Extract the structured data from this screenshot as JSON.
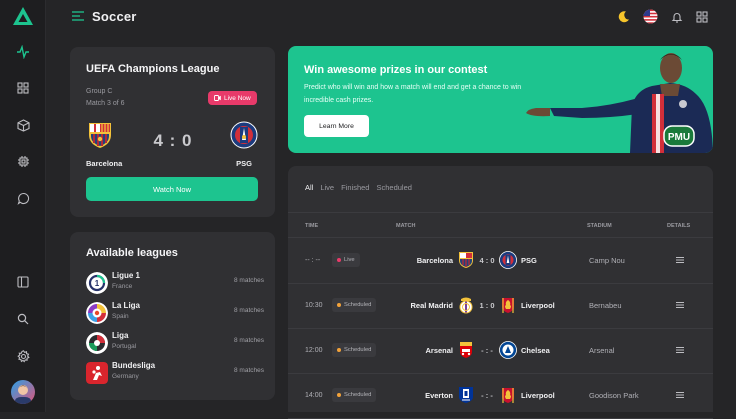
{
  "app": {
    "title": "Soccer"
  },
  "match_card": {
    "league": "UEFA Champions League",
    "group": "Group C",
    "match_no": "Match 3 of 6",
    "live_label": "Live Now",
    "home": "Barcelona",
    "away": "PSG",
    "score": "4 : 0",
    "watch_label": "Watch Now"
  },
  "leagues": {
    "title": "Available leagues",
    "items": [
      {
        "name": "Ligue 1",
        "country": "France",
        "count": "8 matches"
      },
      {
        "name": "La Liga",
        "country": "Spain",
        "count": "8 matches"
      },
      {
        "name": "Liga",
        "country": "Portugal",
        "count": "8 matches"
      },
      {
        "name": "Bundesliga",
        "country": "Germany",
        "count": "8 matches"
      }
    ]
  },
  "promo": {
    "title": "Win awesome prizes in our contest",
    "text": "Predict who will win and how a match will end and get a chance to win incredible cash prizes.",
    "button": "Learn More"
  },
  "table": {
    "tabs": [
      "All",
      "Live",
      "Finished",
      "Scheduled"
    ],
    "headers": {
      "time": "TIME",
      "match": "MATCH",
      "stadium": "STADIUM",
      "details": "DETAILS"
    },
    "rows": [
      {
        "time": "-- : --",
        "status": "Live",
        "home": "Barcelona",
        "score": "4 : 0",
        "away": "PSG",
        "stadium": "Camp Nou"
      },
      {
        "time": "10:30",
        "status": "Scheduled",
        "home": "Real Madrid",
        "score": "1 : 0",
        "away": "Liverpool",
        "stadium": "Bernabeu"
      },
      {
        "time": "12:00",
        "status": "Scheduled",
        "home": "Arsenal",
        "score": "- : -",
        "away": "Chelsea",
        "stadium": "Arsenal"
      },
      {
        "time": "14:00",
        "status": "Scheduled",
        "home": "Everton",
        "score": "- : -",
        "away": "Liverpool",
        "stadium": "Goodison Park"
      }
    ]
  },
  "colors": {
    "accent": "#1dc48f",
    "live": "#e83a6a",
    "scheduled": "#f2a23a",
    "panel": "#303033",
    "background": "#252527"
  }
}
